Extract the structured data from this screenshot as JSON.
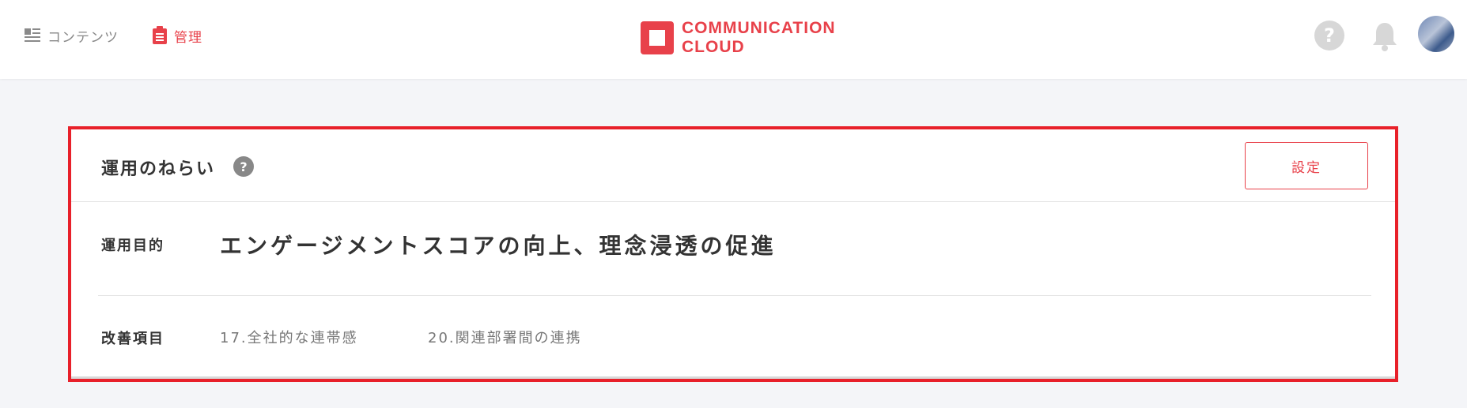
{
  "header": {
    "nav": [
      {
        "label": "コンテンツ",
        "icon": "list-icon"
      },
      {
        "label": "管理",
        "icon": "clipboard-icon"
      }
    ],
    "logo": {
      "line1": "COMMUNICATION",
      "line2": "CLOUD",
      "color": "#e8414a"
    },
    "help_icon": "?",
    "bell_icon": "bell-icon"
  },
  "card": {
    "title": "運用のねらい",
    "title_help": "?",
    "settings_label": "設定",
    "purpose": {
      "label": "運用目的",
      "value": "エンゲージメントスコアの向上、理念浸透の促進"
    },
    "improvement": {
      "label": "改善項目",
      "items": [
        "17.全社的な連帯感",
        "20.関連部署間の連携"
      ]
    },
    "highlight_color": "#e8202a"
  }
}
